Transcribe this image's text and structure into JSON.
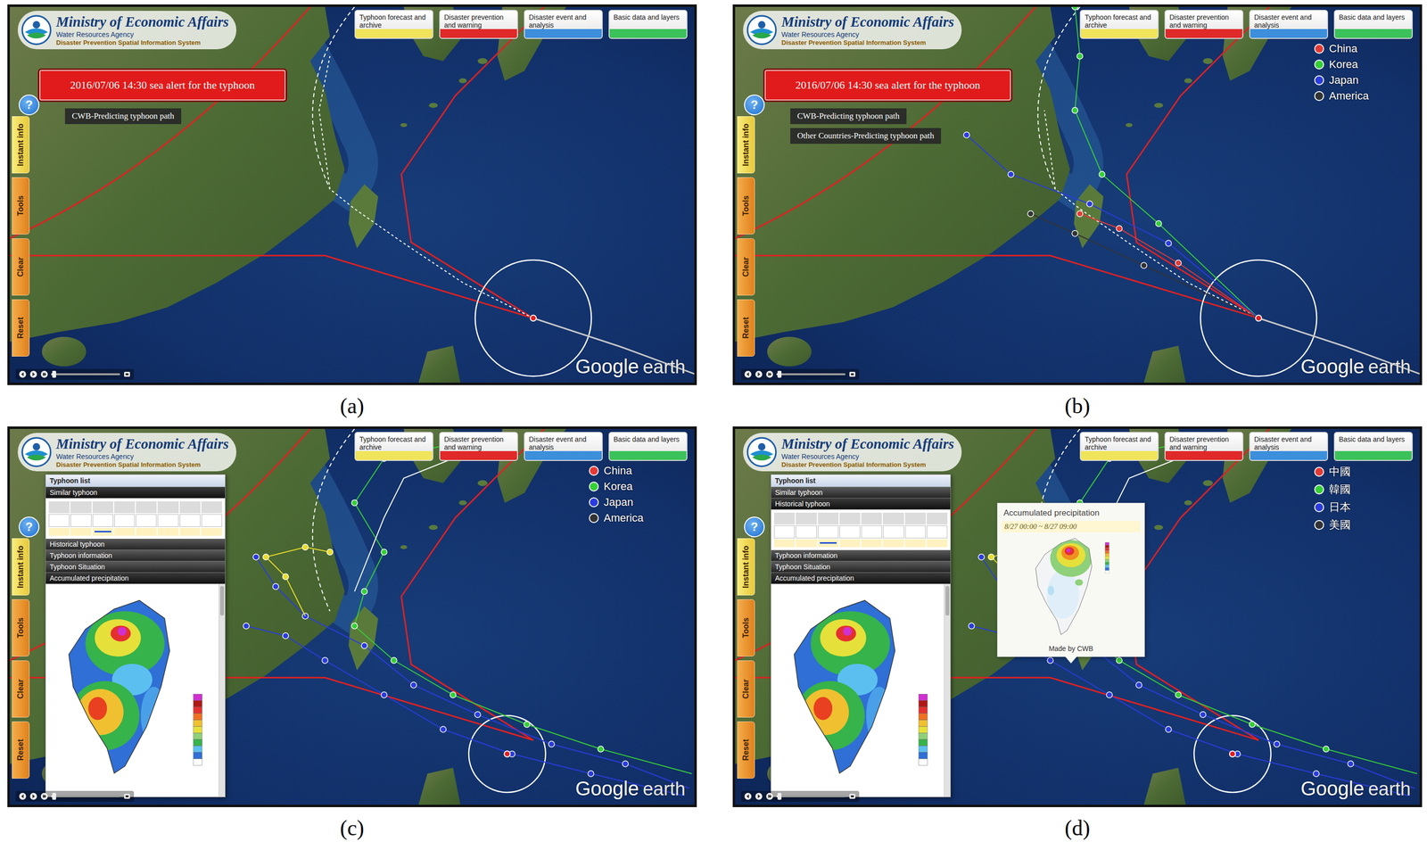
{
  "panels": [
    {
      "caption": "(a)",
      "kind": "cwb",
      "logo": {
        "title": "Ministry of Economic Affairs",
        "agency": "Water Resources Agency",
        "system": "Disaster Prevention Spatial Information System"
      },
      "top_buttons": [
        {
          "label": "Typhoon forecast and archive",
          "color": "#f0e45a"
        },
        {
          "label": "Disaster prevention and warning",
          "color": "#e02a2a"
        },
        {
          "label": "Disaster event and analysis",
          "color": "#3d8fdc"
        },
        {
          "label": "Basic data and layers",
          "color": "#3cc25a"
        }
      ],
      "help": "?",
      "side_tabs": [
        {
          "label": "Instant info",
          "selected": true
        },
        {
          "label": "Tools",
          "selected": false
        },
        {
          "label": "Clear",
          "selected": false
        },
        {
          "label": "Reset",
          "selected": false
        }
      ],
      "alert": "2016/07/06 14:30 sea alert for the typhoon",
      "path_labels": [
        "CWB-Predicting typhoon path"
      ],
      "legend": [],
      "popup": null,
      "tooltip": null,
      "timeline": {
        "level": 0.04
      },
      "watermark": {
        "brand": "Google",
        "product": "earth"
      }
    },
    {
      "caption": "(b)",
      "kind": "multi",
      "logo": {
        "title": "Ministry of Economic Affairs",
        "agency": "Water Resources Agency",
        "system": "Disaster Prevention Spatial Information System"
      },
      "top_buttons": [
        {
          "label": "Typhoon forecast and archive",
          "color": "#f0e45a"
        },
        {
          "label": "Disaster prevention and warning",
          "color": "#e02a2a"
        },
        {
          "label": "Disaster event and analysis",
          "color": "#3d8fdc"
        },
        {
          "label": "Basic data and layers",
          "color": "#3cc25a"
        }
      ],
      "help": "?",
      "side_tabs": [
        {
          "label": "Instant info",
          "selected": true
        },
        {
          "label": "Tools",
          "selected": false
        },
        {
          "label": "Clear",
          "selected": false
        },
        {
          "label": "Reset",
          "selected": false
        }
      ],
      "alert": "2016/07/06 14:30 sea alert for the typhoon",
      "path_labels": [
        "CWB-Predicting typhoon path",
        "Other Countries-Predicting typhoon path"
      ],
      "legend": [
        {
          "label": "China",
          "color": "#e53935"
        },
        {
          "label": "Korea",
          "color": "#35d035"
        },
        {
          "label": "Japan",
          "color": "#2a3ce0"
        },
        {
          "label": "America",
          "color": "#333333"
        }
      ],
      "popup": null,
      "tooltip": null,
      "timeline": {
        "level": 0.04
      },
      "watermark": {
        "brand": "Google",
        "product": "earth"
      }
    },
    {
      "caption": "(c)",
      "kind": "history",
      "logo": {
        "title": "Ministry of Economic Affairs",
        "agency": "Water Resources Agency",
        "system": "Disaster Prevention Spatial Information System"
      },
      "top_buttons": [
        {
          "label": "Typhoon forecast and archive",
          "color": "#f0e45a"
        },
        {
          "label": "Disaster prevention and warning",
          "color": "#e02a2a"
        },
        {
          "label": "Disaster event and analysis",
          "color": "#3d8fdc"
        },
        {
          "label": "Basic data and layers",
          "color": "#3cc25a"
        }
      ],
      "help": "?",
      "side_tabs": [
        {
          "label": "Instant info",
          "selected": true
        },
        {
          "label": "Tools",
          "selected": false
        },
        {
          "label": "Clear",
          "selected": false
        },
        {
          "label": "Reset",
          "selected": false
        }
      ],
      "alert": null,
      "path_labels": [],
      "legend": [
        {
          "label": "China",
          "color": "#e53935"
        },
        {
          "label": "Korea",
          "color": "#35d035"
        },
        {
          "label": "Japan",
          "color": "#2a3ce0"
        },
        {
          "label": "America",
          "color": "#333333"
        }
      ],
      "popup": {
        "title": "Typhoon list",
        "sections": [
          {
            "label": "Similar typhoon",
            "kind": "table",
            "expanded": true
          },
          {
            "label": "Historical typhoon",
            "kind": "table",
            "expanded": false
          },
          {
            "label": "Typhoon information",
            "kind": "info",
            "expanded": false
          },
          {
            "label": "Typhoon Situation",
            "kind": "situation",
            "expanded": false
          },
          {
            "label": "Accumulated precipitation",
            "kind": "map",
            "expanded": true
          }
        ]
      },
      "tooltip": null,
      "timeline": {
        "level": 0.04
      },
      "watermark": {
        "brand": "Google",
        "product": "earth"
      }
    },
    {
      "caption": "(d)",
      "kind": "history",
      "logo": {
        "title": "Ministry of Economic Affairs",
        "agency": "Water Resources Agency",
        "system": "Disaster Prevention Spatial Information System"
      },
      "top_buttons": [
        {
          "label": "Typhoon forecast and archive",
          "color": "#f0e45a"
        },
        {
          "label": "Disaster prevention and warning",
          "color": "#e02a2a"
        },
        {
          "label": "Disaster event and analysis",
          "color": "#3d8fdc"
        },
        {
          "label": "Basic data and layers",
          "color": "#3cc25a"
        }
      ],
      "help": "?",
      "side_tabs": [
        {
          "label": "Instant info",
          "selected": true
        },
        {
          "label": "Tools",
          "selected": false
        },
        {
          "label": "Clear",
          "selected": false
        },
        {
          "label": "Reset",
          "selected": false
        }
      ],
      "alert": null,
      "path_labels": [],
      "legend": [
        {
          "label": "中國",
          "color": "#e53935"
        },
        {
          "label": "韓國",
          "color": "#35d035"
        },
        {
          "label": "日本",
          "color": "#2a3ce0"
        },
        {
          "label": "美國",
          "color": "#333333"
        }
      ],
      "popup": {
        "title": "Typhoon list",
        "sections": [
          {
            "label": "Similar typhoon",
            "kind": "table",
            "expanded": false
          },
          {
            "label": "Historical typhoon",
            "kind": "table",
            "expanded": true
          },
          {
            "label": "Typhoon information",
            "kind": "info",
            "expanded": false
          },
          {
            "label": "Typhoon Situation",
            "kind": "situation",
            "expanded": false
          },
          {
            "label": "Accumulated precipitation",
            "kind": "map",
            "expanded": true
          }
        ]
      },
      "tooltip": {
        "title": "Accumulated precipitation",
        "period": "8/27 00:00 ~ 8/27 09:00",
        "credit": "Made by CWB"
      },
      "timeline": {
        "level": 0.04
      },
      "watermark": {
        "brand": "Google",
        "product": "earth"
      }
    }
  ]
}
